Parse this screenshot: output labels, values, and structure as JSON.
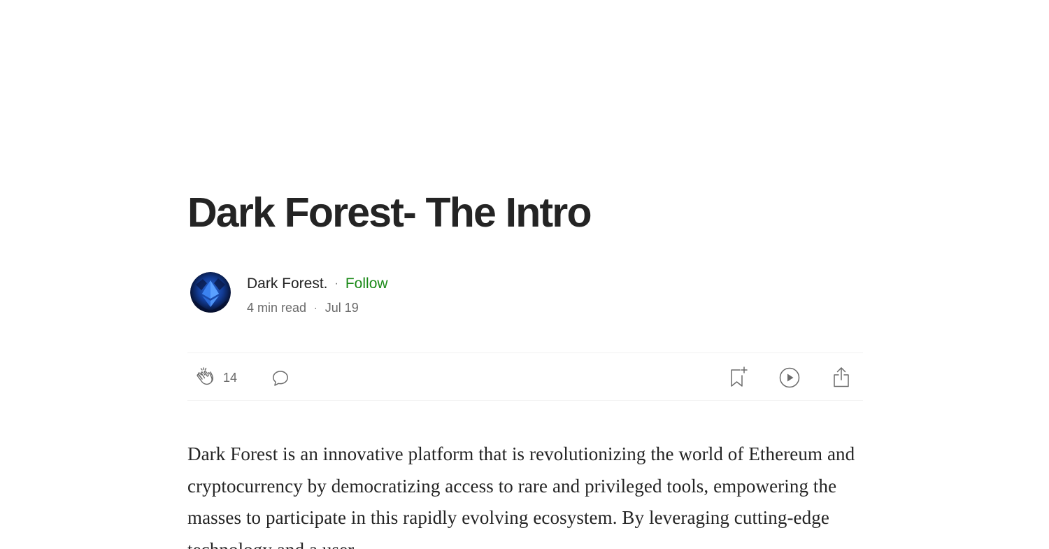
{
  "article": {
    "title": "Dark Forest- The Intro",
    "author": {
      "name": "Dark Forest.",
      "follow_label": "Follow",
      "separator": "·"
    },
    "meta": {
      "read_time": "4 min read",
      "separator": "·",
      "date": "Jul 19"
    },
    "actions": {
      "clap_count": "14",
      "icons": [
        "clap-icon",
        "comment-icon",
        "bookmark-add-icon",
        "listen-play-icon",
        "share-icon"
      ]
    },
    "body": "Dark Forest is an innovative platform that is revolutionizing the world of Ethereum and cryptocurrency by democratizing access to rare and privileged tools, empowering the masses to participate in this rapidly evolving ecosystem. By leveraging cutting-edge technology and a user-"
  },
  "colors": {
    "text": "#242424",
    "muted": "#6b6b6b",
    "follow": "#1a8917",
    "divider": "#f2f2f2"
  }
}
